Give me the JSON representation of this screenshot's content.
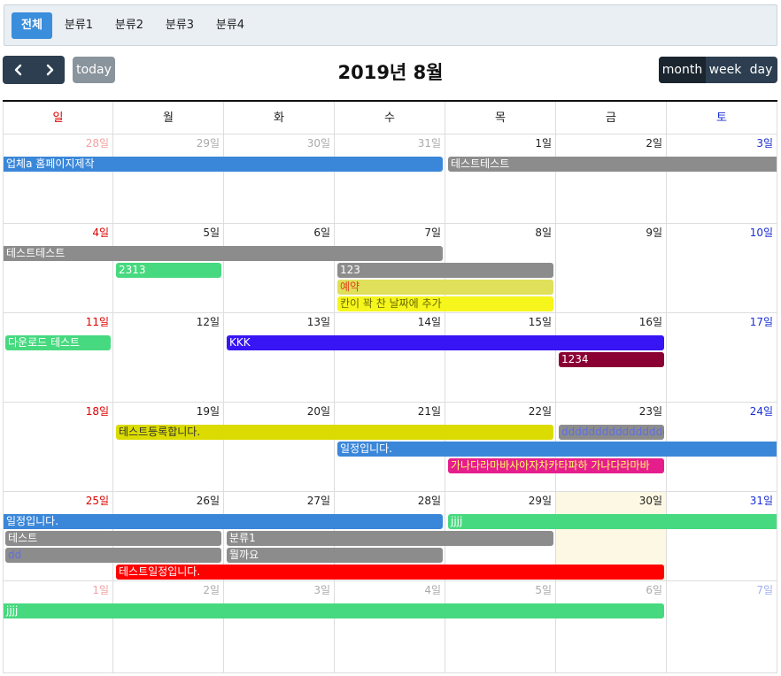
{
  "categories": [
    {
      "label": "전체",
      "active": true
    },
    {
      "label": "분류1",
      "active": false
    },
    {
      "label": "분류2",
      "active": false
    },
    {
      "label": "분류3",
      "active": false
    },
    {
      "label": "분류4",
      "active": false
    }
  ],
  "toolbar": {
    "prev_icon": "chevron-left-icon",
    "next_icon": "chevron-right-icon",
    "today_label": "today",
    "title": "2019년 8월",
    "views": [
      "month",
      "week",
      "day"
    ],
    "active_view": "month"
  },
  "weekdays": [
    "일",
    "월",
    "화",
    "수",
    "목",
    "금",
    "토"
  ],
  "weeks": [
    {
      "days": [
        {
          "label": "28일",
          "other": true
        },
        {
          "label": "29일",
          "other": true
        },
        {
          "label": "30일",
          "other": true
        },
        {
          "label": "31일",
          "other": true
        },
        {
          "label": "1일"
        },
        {
          "label": "2일"
        },
        {
          "label": "3일"
        }
      ]
    },
    {
      "days": [
        {
          "label": "4일"
        },
        {
          "label": "5일"
        },
        {
          "label": "6일"
        },
        {
          "label": "7일"
        },
        {
          "label": "8일"
        },
        {
          "label": "9일"
        },
        {
          "label": "10일"
        }
      ]
    },
    {
      "days": [
        {
          "label": "11일"
        },
        {
          "label": "12일"
        },
        {
          "label": "13일"
        },
        {
          "label": "14일"
        },
        {
          "label": "15일"
        },
        {
          "label": "16일"
        },
        {
          "label": "17일"
        }
      ]
    },
    {
      "days": [
        {
          "label": "18일"
        },
        {
          "label": "19일"
        },
        {
          "label": "20일"
        },
        {
          "label": "21일"
        },
        {
          "label": "22일"
        },
        {
          "label": "23일"
        },
        {
          "label": "24일"
        }
      ]
    },
    {
      "days": [
        {
          "label": "25일"
        },
        {
          "label": "26일"
        },
        {
          "label": "27일"
        },
        {
          "label": "28일"
        },
        {
          "label": "29일"
        },
        {
          "label": "30일",
          "today": true
        },
        {
          "label": "31일"
        }
      ]
    },
    {
      "days": [
        {
          "label": "1일",
          "other": true
        },
        {
          "label": "2일",
          "other": true
        },
        {
          "label": "3일",
          "other": true
        },
        {
          "label": "4일",
          "other": true
        },
        {
          "label": "5일",
          "other": true
        },
        {
          "label": "6일",
          "other": true
        },
        {
          "label": "7일",
          "other": true
        }
      ]
    }
  ],
  "events": [
    {
      "title": "업체a 홈페이지제작",
      "week": 0,
      "start": 0,
      "end": 3,
      "row": 0,
      "color": "#3a87d9",
      "text": "#ffffff",
      "cont_left": true,
      "cont_right": false
    },
    {
      "title": "테스트테스트",
      "week": 0,
      "start": 4,
      "end": 6,
      "row": 0,
      "color": "#8c8c8c",
      "text": "#ffffff",
      "cont_left": false,
      "cont_right": true
    },
    {
      "title": "테스트테스트",
      "week": 1,
      "start": 0,
      "end": 3,
      "row": 0,
      "color": "#8c8c8c",
      "text": "#ffffff",
      "cont_left": true,
      "cont_right": false
    },
    {
      "title": "2313",
      "week": 1,
      "start": 1,
      "end": 1,
      "row": 1,
      "color": "#47d97f",
      "text": "#ffffff",
      "cont_left": false,
      "cont_right": false
    },
    {
      "title": "123",
      "week": 1,
      "start": 3,
      "end": 4,
      "row": 1,
      "color": "#8c8c8c",
      "text": "#ffffff",
      "cont_left": false,
      "cont_right": false
    },
    {
      "title": "예약",
      "week": 1,
      "start": 3,
      "end": 4,
      "row": 2,
      "color": "#e0e05a",
      "text": "#e0411c",
      "cont_left": false,
      "cont_right": false
    },
    {
      "title": "칸이 꽉 찬 날짜에 추가",
      "week": 1,
      "start": 3,
      "end": 4,
      "row": 3,
      "color": "#f6f61c",
      "text": "#6a6a00",
      "cont_left": false,
      "cont_right": false
    },
    {
      "title": "다운로드 테스트",
      "week": 2,
      "start": 0,
      "end": 0,
      "row": 0,
      "color": "#47d97f",
      "text": "#ffffff",
      "cont_left": false,
      "cont_right": false
    },
    {
      "title": "KKK",
      "week": 2,
      "start": 2,
      "end": 5,
      "row": 0,
      "color": "#3815f5",
      "text": "#ffffff",
      "cont_left": false,
      "cont_right": false
    },
    {
      "title": "1234",
      "week": 2,
      "start": 5,
      "end": 5,
      "row": 1,
      "color": "#8a0033",
      "text": "#ffffff",
      "cont_left": false,
      "cont_right": false
    },
    {
      "title": "테스트등록합니다.",
      "week": 3,
      "start": 1,
      "end": 4,
      "row": 0,
      "color": "#dbdb00",
      "text": "#333333",
      "cont_left": false,
      "cont_right": false
    },
    {
      "title": "dddddddddddddddd",
      "week": 3,
      "start": 5,
      "end": 5,
      "row": 0,
      "color": "#8c8c8c",
      "text": "#5f6fe0",
      "cont_left": false,
      "cont_right": false
    },
    {
      "title": "일정입니다.",
      "week": 3,
      "start": 3,
      "end": 6,
      "row": 1,
      "color": "#3a87d9",
      "text": "#ffffff",
      "cont_left": false,
      "cont_right": true
    },
    {
      "title": "가나다라마바사아자차카타파하 가나다라마바",
      "week": 3,
      "start": 4,
      "end": 5,
      "row": 2,
      "color": "#e61e8c",
      "text": "#ffff66",
      "cont_left": false,
      "cont_right": false
    },
    {
      "title": "일정입니다.",
      "week": 4,
      "start": 0,
      "end": 3,
      "row": 0,
      "color": "#3a87d9",
      "text": "#ffffff",
      "cont_left": true,
      "cont_right": false
    },
    {
      "title": "jjjj",
      "week": 4,
      "start": 4,
      "end": 6,
      "row": 0,
      "color": "#47d97f",
      "text": "#ffffff",
      "cont_left": false,
      "cont_right": true
    },
    {
      "title": "테스트",
      "week": 4,
      "start": 0,
      "end": 1,
      "row": 1,
      "color": "#8c8c8c",
      "text": "#ffffff",
      "cont_left": false,
      "cont_right": false
    },
    {
      "title": "분류1",
      "week": 4,
      "start": 2,
      "end": 4,
      "row": 1,
      "color": "#8c8c8c",
      "text": "#ffffff",
      "cont_left": false,
      "cont_right": false
    },
    {
      "title": "dd",
      "week": 4,
      "start": 0,
      "end": 1,
      "row": 2,
      "color": "#8c8c8c",
      "text": "#5f6fe0",
      "cont_left": false,
      "cont_right": false
    },
    {
      "title": "뭘까요",
      "week": 4,
      "start": 2,
      "end": 3,
      "row": 2,
      "color": "#8c8c8c",
      "text": "#ffffff",
      "cont_left": false,
      "cont_right": false
    },
    {
      "title": "테스트일정입니다.",
      "week": 4,
      "start": 1,
      "end": 5,
      "row": 3,
      "color": "#ff0000",
      "text": "#ffffff",
      "cont_left": false,
      "cont_right": false
    },
    {
      "title": "jjjj",
      "week": 5,
      "start": 0,
      "end": 5,
      "row": 0,
      "color": "#47d97f",
      "text": "#ffffff",
      "cont_left": true,
      "cont_right": false
    }
  ]
}
